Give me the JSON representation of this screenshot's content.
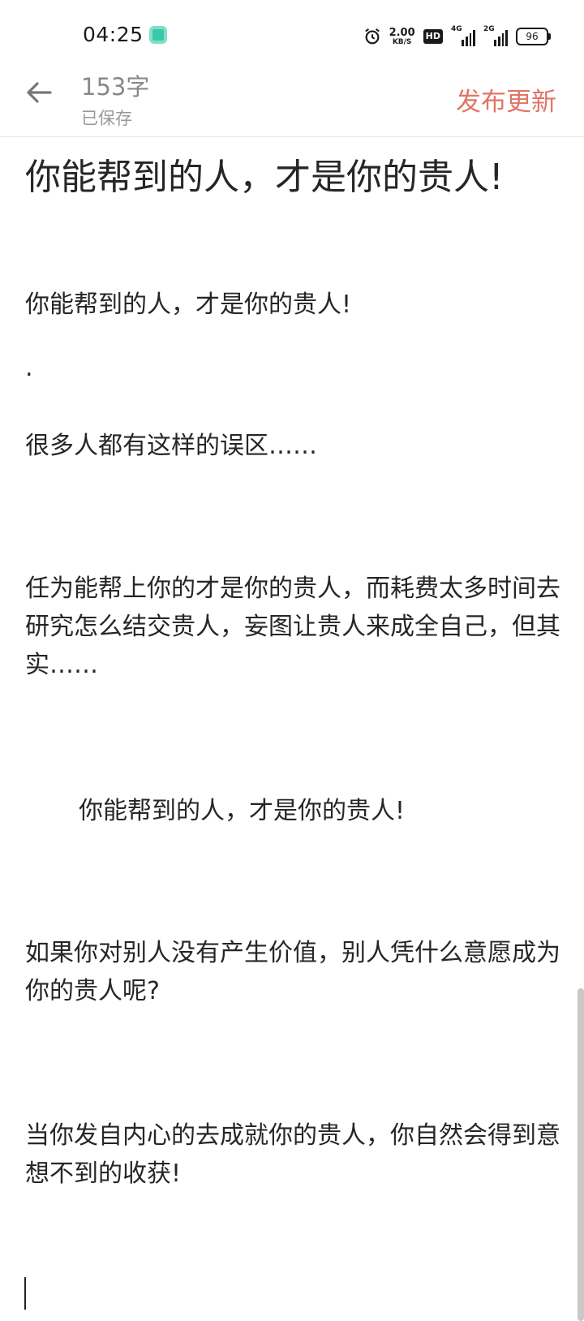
{
  "status_bar": {
    "time": "04:25",
    "net_speed_value": "2.00",
    "net_speed_unit": "KB/S",
    "hd_label": "HD",
    "signal1_tag": "4G",
    "signal2_tag": "2G",
    "battery": "96"
  },
  "header": {
    "word_count": "153字",
    "save_status": "已保存",
    "publish_label": "发布更新"
  },
  "article": {
    "title": "你能帮到的人，才是你的贵人!",
    "paragraphs": [
      "你能帮到的人，才是你的贵人!",
      ".",
      "很多人都有这样的误区……",
      "任为能帮上你的才是你的贵人，而耗费太多时间去研究怎么结交贵人，妄图让贵人来成全自己，但其实……",
      "你能帮到的人，才是你的贵人!",
      "如果你对别人没有产生价值，别人凭什么意愿成为你的贵人呢?",
      "当你发自内心的去成就你的贵人，你自然会得到意想不到的收获!"
    ]
  },
  "colors": {
    "accent": "#e07566",
    "text": "#262626",
    "muted": "#888888"
  }
}
